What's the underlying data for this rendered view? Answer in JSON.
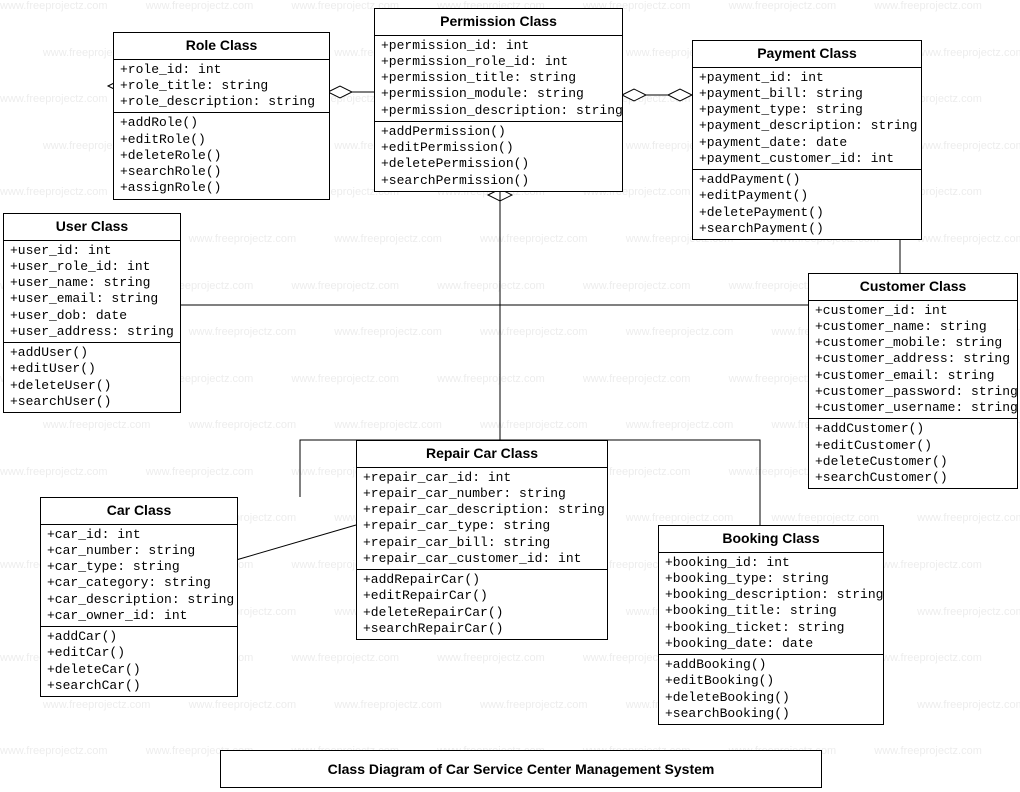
{
  "watermark_text": "www.freeprojectz.com",
  "caption": "Class Diagram of Car Service Center Management System",
  "classes": {
    "role": {
      "title": "Role Class",
      "attrs": [
        "+role_id: int",
        "+role_title: string",
        "+role_description: string"
      ],
      "ops": [
        "+addRole()",
        "+editRole()",
        "+deleteRole()",
        "+searchRole()",
        "+assignRole()"
      ]
    },
    "permission": {
      "title": "Permission Class",
      "attrs": [
        "+permission_id: int",
        "+permission_role_id: int",
        "+permission_title: string",
        "+permission_module: string",
        "+permission_description: string"
      ],
      "ops": [
        "+addPermission()",
        "+editPermission()",
        "+deletePermission()",
        "+searchPermission()"
      ]
    },
    "payment": {
      "title": "Payment Class",
      "attrs": [
        "+payment_id: int",
        "+payment_bill: string",
        "+payment_type: string",
        "+payment_description: string",
        "+payment_date: date",
        "+payment_customer_id: int"
      ],
      "ops": [
        "+addPayment()",
        "+editPayment()",
        "+deletePayment()",
        "+searchPayment()"
      ]
    },
    "user": {
      "title": "User Class",
      "attrs": [
        "+user_id: int",
        "+user_role_id: int",
        "+user_name: string",
        "+user_email: string",
        "+user_dob: date",
        "+user_address: string"
      ],
      "ops": [
        "+addUser()",
        "+editUser()",
        "+deleteUser()",
        "+searchUser()"
      ]
    },
    "customer": {
      "title": "Customer Class",
      "attrs": [
        "+customer_id: int",
        "+customer_name: string",
        "+customer_mobile: string",
        "+customer_address: string",
        "+customer_email: string",
        "+customer_password: string",
        "+customer_username: string"
      ],
      "ops": [
        "+addCustomer()",
        "+editCustomer()",
        "+deleteCustomer()",
        "+searchCustomer()"
      ]
    },
    "repair": {
      "title": "Repair Car Class",
      "attrs": [
        "+repair_car_id: int",
        "+repair_car_number: string",
        "+repair_car_description: string",
        "+repair_car_type: string",
        "+repair_car_bill: string",
        "+repair_car_customer_id: int"
      ],
      "ops": [
        "+addRepairCar()",
        "+editRepairCar()",
        "+deleteRepairCar()",
        "+searchRepairCar()"
      ]
    },
    "car": {
      "title": "Car Class",
      "attrs": [
        "+car_id: int",
        "+car_number: string",
        "+car_type: string",
        "+car_category: string",
        "+car_description: string",
        "+car_owner_id: int"
      ],
      "ops": [
        "+addCar()",
        "+editCar()",
        "+deleteCar()",
        "+searchCar()"
      ]
    },
    "booking": {
      "title": "Booking Class",
      "attrs": [
        "+booking_id: int",
        "+booking_type: string",
        "+booking_description: string",
        "+booking_title: string",
        "+booking_ticket: string",
        "+booking_date: date"
      ],
      "ops": [
        "+addBooking()",
        "+editBooking()",
        "+deleteBooking()",
        "+searchBooking()"
      ]
    }
  }
}
